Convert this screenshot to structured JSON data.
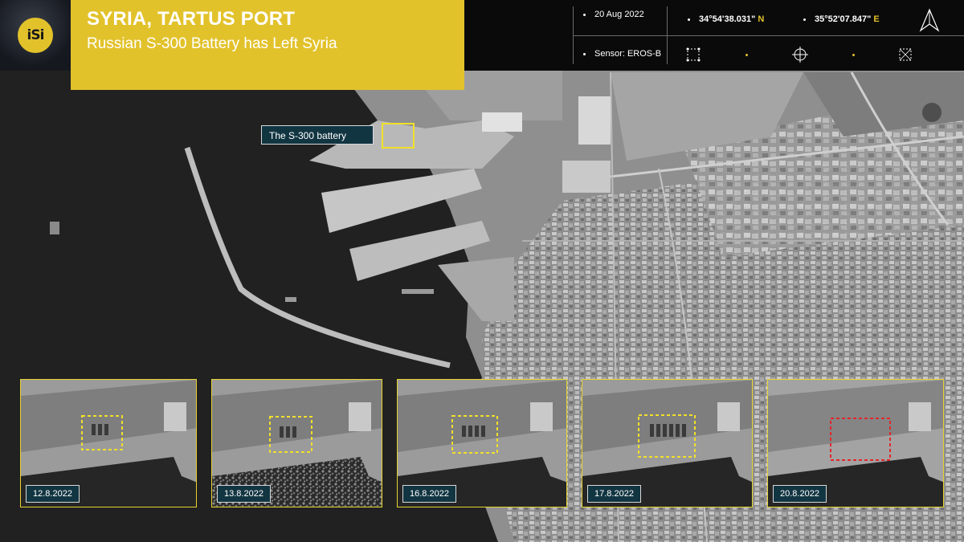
{
  "header": {
    "logo_text": "iSi",
    "title": "SYRIA, TARTUS PORT",
    "subtitle": "Russian S-300 Battery has Left Syria"
  },
  "info": {
    "date": "20 Aug 2022",
    "latitude_value": "34°54'38.031\"",
    "latitude_hemi": "N",
    "longitude_value": "35°52'07.847\"",
    "longitude_hemi": "E",
    "sensor": "Sensor: EROS-B"
  },
  "map": {
    "battery_label": "The S-300 battery"
  },
  "insets": [
    {
      "date": "12.8.2022",
      "box_color": "#f1e02a"
    },
    {
      "date": "13.8.2022",
      "box_color": "#f1e02a"
    },
    {
      "date": "16.8.2022",
      "box_color": "#f1e02a"
    },
    {
      "date": "17.8.2022",
      "box_color": "#f1e02a"
    },
    {
      "date": "20.8.2022",
      "box_color": "#e3262b"
    }
  ],
  "colors": {
    "brand_yellow": "#e2c22b",
    "label_bg": "#123542",
    "highlight_yellow": "#f1e02a",
    "empty_red": "#e3262b"
  }
}
